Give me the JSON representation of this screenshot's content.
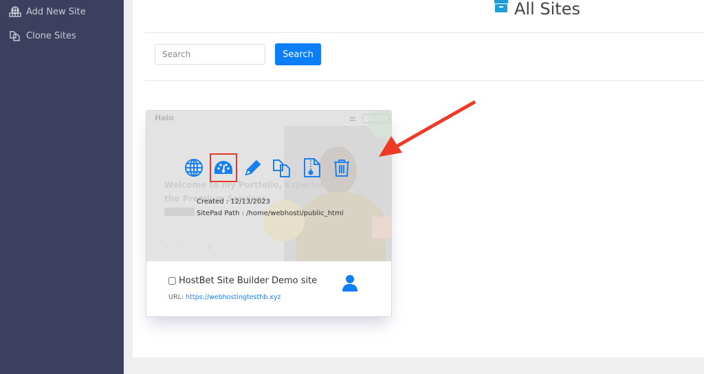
{
  "sidebar": {
    "items": [
      {
        "label": "Add New Site",
        "icon": "globe-building-icon"
      },
      {
        "label": "Clone Sites",
        "icon": "clone-icon"
      }
    ]
  },
  "header": {
    "title": "All Sites",
    "title_icon": "archive-box-icon"
  },
  "search": {
    "placeholder": "Search",
    "value": "",
    "button_label": "Search"
  },
  "colors": {
    "accent": "#0c7ef7",
    "highlight": "#e8362a",
    "sidebar_bg": "#3d3f5e"
  },
  "site_card": {
    "preview": {
      "logo": "Halo",
      "headline": "Welcome to my Portfolio, Experience the Premium Services"
    },
    "actions": [
      {
        "name": "visit-site",
        "icon": "globe-icon"
      },
      {
        "name": "dashboard",
        "icon": "dashboard-gauge-icon",
        "highlighted": true
      },
      {
        "name": "edit",
        "icon": "pencil-icon"
      },
      {
        "name": "clone",
        "icon": "clone-icon"
      },
      {
        "name": "backup",
        "icon": "zip-file-icon"
      },
      {
        "name": "delete",
        "icon": "trash-icon"
      }
    ],
    "created_label": "Created : 12/13/2023",
    "path_label": "SitePad Path : /home/webhosti/public_html",
    "site_name": "HostBet Site Builder Demo site",
    "url_prefix": "URL:",
    "url": "https://webhostingtesthb.xyz",
    "checked": false
  }
}
